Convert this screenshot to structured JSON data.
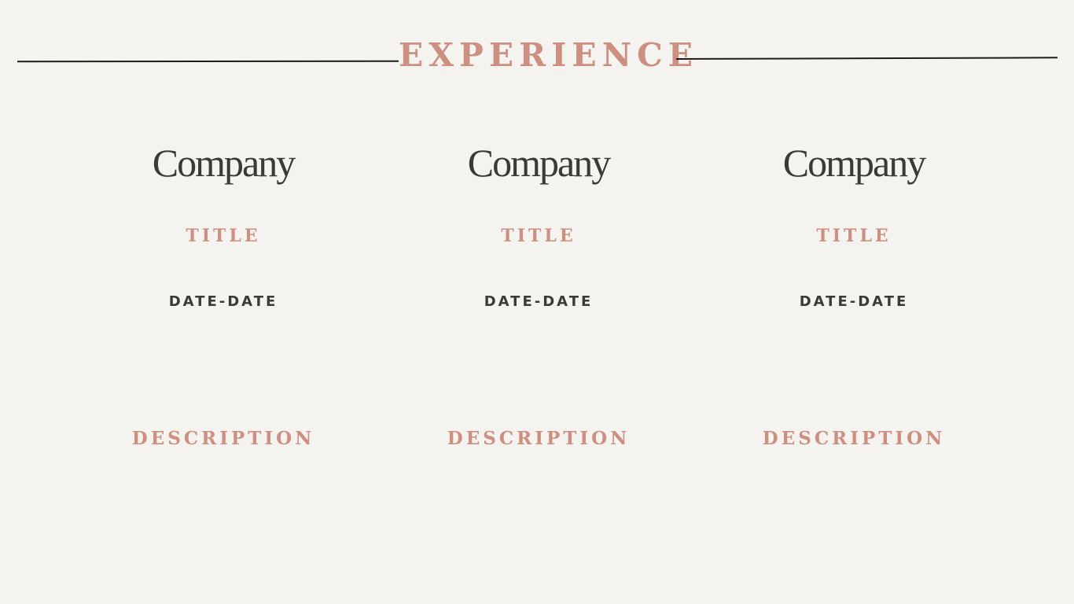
{
  "section": {
    "title": "EXPERIENCE"
  },
  "entries": [
    {
      "company": "Company",
      "title": "TITLE",
      "dates": "DATE-DATE",
      "description": "DESCRIPTION"
    },
    {
      "company": "Company",
      "title": "TITLE",
      "dates": "DATE-DATE",
      "description": "DESCRIPTION"
    },
    {
      "company": "Company",
      "title": "TITLE",
      "dates": "DATE-DATE",
      "description": "DESCRIPTION"
    }
  ],
  "colors": {
    "background": "#f5f3f0",
    "accent": "#cc8f80",
    "text": "#3a3a38",
    "rule": "#1c1c1c"
  }
}
